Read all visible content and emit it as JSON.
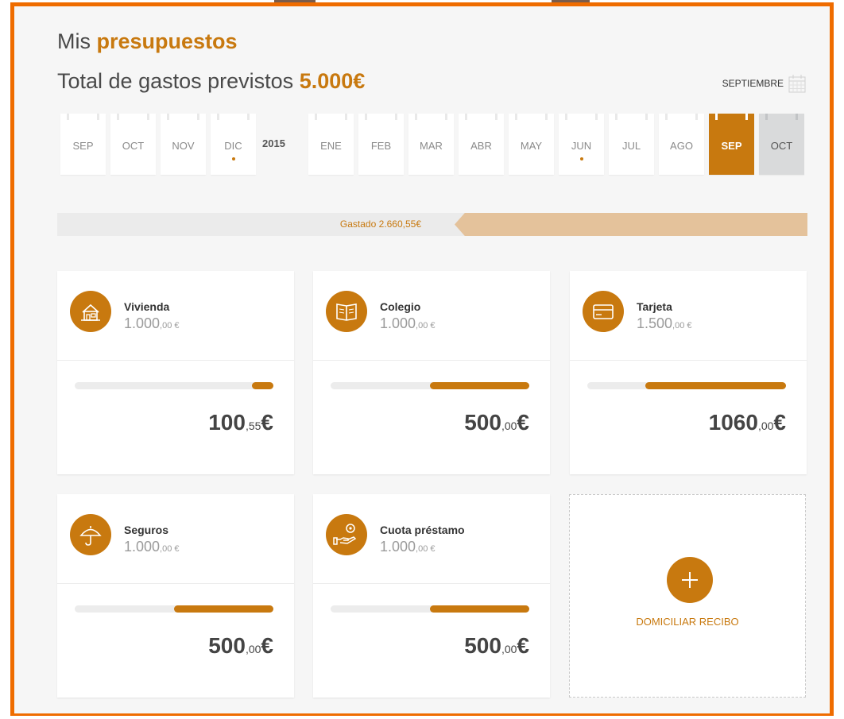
{
  "header": {
    "title_prefix": "Mis",
    "title_accent": "presupuestos",
    "subtitle_prefix": "Total de gastos previstos",
    "subtitle_amount": "5.000€",
    "month_selector": "SEPTIEMBRE",
    "month_selector_icon": "calendar-icon"
  },
  "timeline": {
    "year_label": "2015",
    "months_before": [
      {
        "label": "SEP",
        "dot": false
      },
      {
        "label": "OCT",
        "dot": false
      },
      {
        "label": "NOV",
        "dot": false
      },
      {
        "label": "DIC",
        "dot": true
      }
    ],
    "months_after": [
      {
        "label": "ENE",
        "dot": false
      },
      {
        "label": "FEB",
        "dot": false
      },
      {
        "label": "MAR",
        "dot": false
      },
      {
        "label": "ABR",
        "dot": false
      },
      {
        "label": "MAY",
        "dot": false
      },
      {
        "label": "JUN",
        "dot": true
      },
      {
        "label": "JUL",
        "dot": false
      },
      {
        "label": "AGO",
        "dot": false
      },
      {
        "label": "SEP",
        "dot": false,
        "active": true
      },
      {
        "label": "OCT",
        "dot": false,
        "next": true
      }
    ]
  },
  "spent": {
    "label": "Gastado 2.660,55€",
    "fraction": 0.53
  },
  "categories": [
    {
      "name": "Vivienda",
      "budget_int": "1.000",
      "budget_dec": ",00 €",
      "spent_int": "100",
      "spent_dec": ",55",
      "currency": "€",
      "progress": 0.11,
      "icon": "house-icon"
    },
    {
      "name": "Colegio",
      "budget_int": "1.000",
      "budget_dec": ",00 €",
      "spent_int": "500",
      "spent_dec": ",00",
      "currency": "€",
      "progress": 0.5,
      "icon": "book-icon"
    },
    {
      "name": "Tarjeta",
      "budget_int": "1.500",
      "budget_dec": ",00 €",
      "spent_int": "1060",
      "spent_dec": ",00",
      "currency": "€",
      "progress": 0.71,
      "icon": "credit-card-icon"
    },
    {
      "name": "Seguros",
      "budget_int": "1.000",
      "budget_dec": ",00 €",
      "spent_int": "500",
      "spent_dec": ",00",
      "currency": "€",
      "progress": 0.5,
      "icon": "umbrella-icon"
    },
    {
      "name": "Cuota préstamo",
      "budget_int": "1.000",
      "budget_dec": ",00 €",
      "spent_int": "500",
      "spent_dec": ",00",
      "currency": "€",
      "progress": 0.5,
      "icon": "loan-hand-coin-icon"
    }
  ],
  "add_card": {
    "label": "DOMICILIAR RECIBO",
    "icon": "plus-icon"
  },
  "colors": {
    "accent": "#c8790f",
    "frame": "#ef6c00",
    "spent_fill": "#e4c29b"
  }
}
